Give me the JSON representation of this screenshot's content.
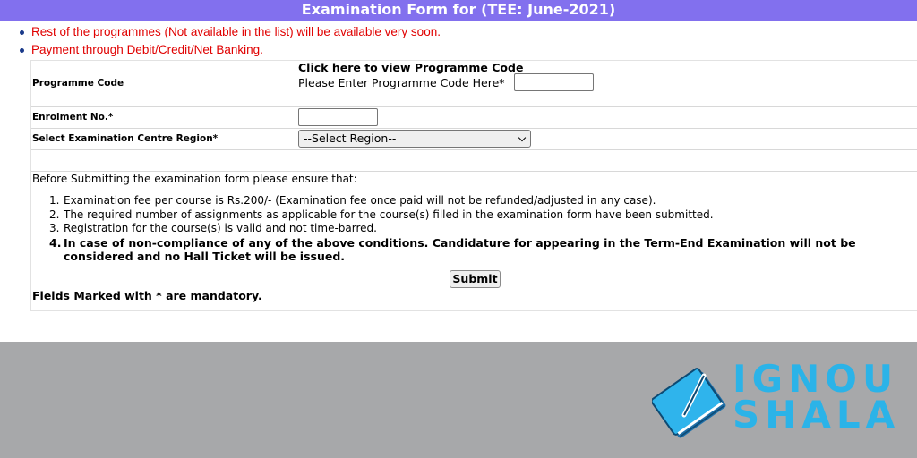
{
  "header": {
    "title": "Examination Form for (TEE: June-2021)"
  },
  "notes": [
    "Rest of the programmes (Not available in the list) will be available very soon.",
    "Payment through Debit/Credit/Net Banking."
  ],
  "form": {
    "programme": {
      "label": "Programme Code",
      "link": "Click here to view Programme Code",
      "prompt": "Please Enter Programme Code Here*",
      "value": ""
    },
    "enrolment": {
      "label": "Enrolment No.*",
      "value": ""
    },
    "region": {
      "label": "Select Examination Centre Region*",
      "selected": "--Select Region--"
    }
  },
  "instructions": {
    "intro": "Before Submitting the examination form please ensure that:",
    "items": [
      {
        "num": "1.",
        "text": "Examination fee per course is Rs.200/- (Examination fee once paid will not be refunded/adjusted in any case)."
      },
      {
        "num": "2.",
        "text": "The required number of assignments as applicable for the course(s) filled in the examination form have been submitted."
      },
      {
        "num": "3.",
        "text": "Registration for the course(s) is valid and not time-barred."
      },
      {
        "num": "4.",
        "text": "In case of non-compliance of any of the above conditions. Candidature for appearing in the Term-End Examination will not be considered and no Hall Ticket will be issued."
      }
    ]
  },
  "submit_label": "Submit",
  "mandatory_note": "Fields Marked with * are mandatory.",
  "brand": {
    "line1": "IGNOU",
    "line2": "SHALA"
  },
  "colors": {
    "header": "#8270ee",
    "notes": "#e00000",
    "footer": "#a7a8aa",
    "brand": "#2bb3e8"
  }
}
